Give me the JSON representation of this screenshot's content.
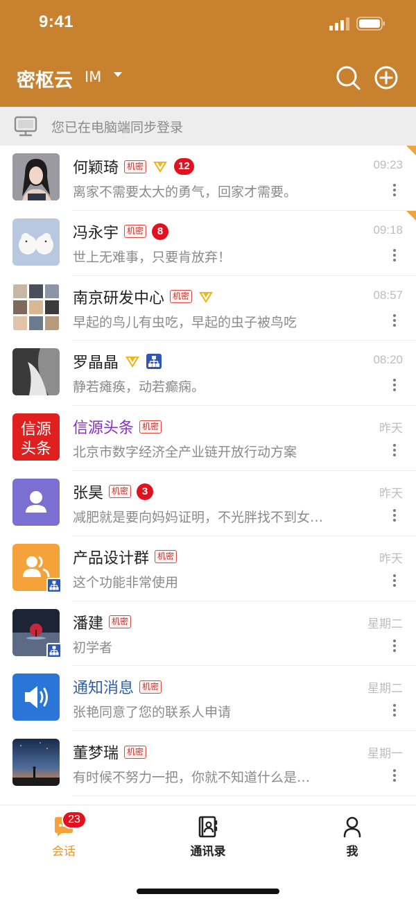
{
  "status_bar": {
    "time": "9:41"
  },
  "header": {
    "title": "密枢云",
    "subtitle": "IM",
    "accent_color": "#c8822f"
  },
  "sync_banner": {
    "text": "您已在电脑端同步登录",
    "icon": "desktop-icon"
  },
  "conversations": [
    {
      "name": "何颖琦",
      "tag": "机密",
      "vip": true,
      "unread": "12",
      "preview": "离家不需要太大的勇气，回家才需要。",
      "time": "09:23",
      "pinned": true
    },
    {
      "name": "冯永宇",
      "tag": "机密",
      "unread": "8",
      "preview": "世上无难事，只要肯放弃！",
      "time": "09:18",
      "pinned": true
    },
    {
      "name": "南京研发中心",
      "tag": "机密",
      "vip": true,
      "preview": "早起的鸟儿有虫吃，早起的虫子被鸟吃",
      "time": "08:57"
    },
    {
      "name": "罗晶晶",
      "vip": true,
      "org": true,
      "preview": "静若瘫痪，动若癫痫。",
      "time": "08:20"
    },
    {
      "name": "信源头条",
      "tag": "机密",
      "preview": "北京市数字经济全产业链开放行动方案",
      "time": "昨天",
      "avatar_text_1": "信源",
      "avatar_text_2": "头条"
    },
    {
      "name": "张昊",
      "tag": "机密",
      "unread": "3",
      "preview": "减肥就是要向妈妈证明，不光胖找不到女…",
      "time": "昨天"
    },
    {
      "name": "产品设计群",
      "tag": "机密",
      "preview": "这个功能非常使用",
      "time": "昨天"
    },
    {
      "name": "潘建",
      "tag": "机密",
      "preview": "初学者",
      "time": "星期二"
    },
    {
      "name": "通知消息",
      "tag": "机密",
      "preview": "张艳同意了您的联系人申请",
      "time": "星期二"
    },
    {
      "name": "董梦瑞",
      "tag": "机密",
      "preview": "有时候不努力一把，你就不知道什么是…",
      "time": "星期一"
    }
  ],
  "tabbar": {
    "tabs": [
      {
        "label": "会话",
        "icon": "chat-icon",
        "badge": "23",
        "active": true
      },
      {
        "label": "通讯录",
        "icon": "contacts-icon"
      },
      {
        "label": "我",
        "icon": "person-icon"
      }
    ],
    "active_color": "#e8952a"
  }
}
